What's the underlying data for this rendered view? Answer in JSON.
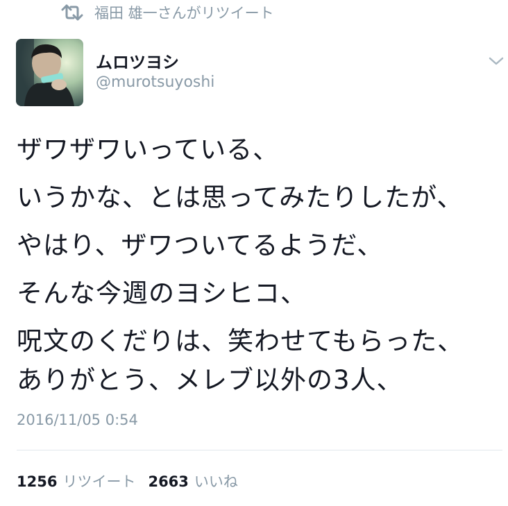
{
  "retweet_context": {
    "icon": "retweet-icon",
    "text": "福田 雄一さんがリツイート"
  },
  "author": {
    "display_name": "ムロツヨシ",
    "screen_name": "@murotsuyoshi",
    "avatar": "user-avatar-photo"
  },
  "menu": {
    "icon": "chevron-down-icon"
  },
  "tweet": {
    "lines": [
      "ザワザワいっている、",
      "いうかな、とは思ってみたりしたが、",
      "やはり、ザワついてるようだ、",
      "そんな今週のヨシヒコ、",
      "呪文のくだりは、笑わせてもらった、",
      "ありがとう、メレブ以外の3人、"
    ],
    "timestamp": "2016/11/05 0:54"
  },
  "stats": {
    "retweets_count": "1256",
    "retweets_label": "リツイート",
    "likes_count": "2663",
    "likes_label": "いいね"
  },
  "colors": {
    "text": "#141823",
    "muted": "#8899a6",
    "divider": "#e1e8ed"
  }
}
